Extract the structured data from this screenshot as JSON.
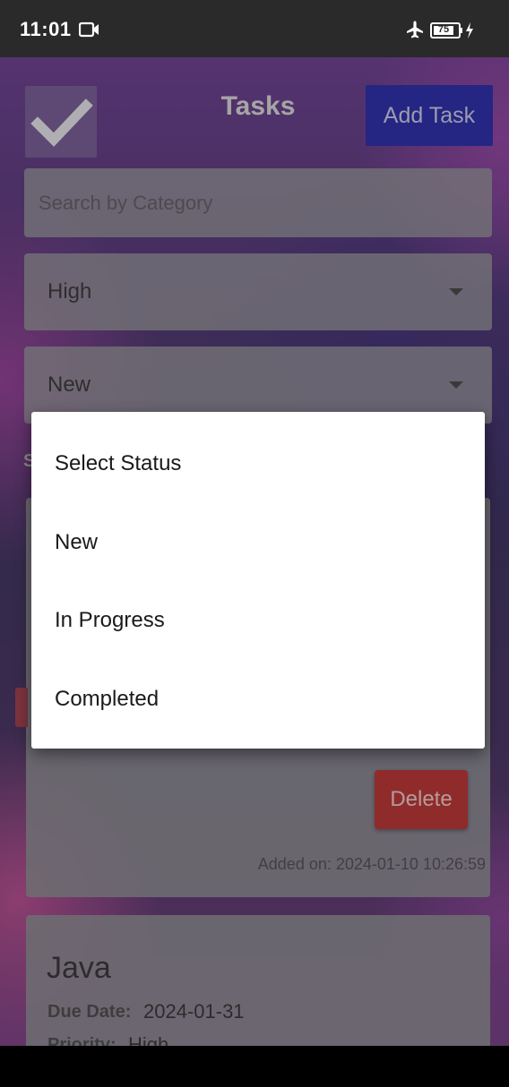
{
  "status_bar": {
    "time": "11:01",
    "battery": "75",
    "icons": [
      "video-record-icon",
      "airplane-icon",
      "battery-icon",
      "charging-icon"
    ]
  },
  "header": {
    "title": "Tasks",
    "logo_icon": "checkmark-icon",
    "add_button_label": "Add Task"
  },
  "filters": {
    "search_placeholder": "Search by Category",
    "priority_selected": "High",
    "status_selected": "New",
    "section_fragment": "S"
  },
  "status_menu": {
    "options": [
      "Select Status",
      "New",
      "In Progress",
      "Completed"
    ]
  },
  "task_card_1": {
    "delete_label": "Delete",
    "added_on": "Added on: 2024-01-10 10:26:59"
  },
  "task_card_2": {
    "title": "Java",
    "due_label": "Due Date:",
    "due_value": "2024-01-31",
    "priority_label": "Priority:",
    "priority_value": "High"
  },
  "colors": {
    "add_button": "#1414a6",
    "delete_button": "#b81e1e",
    "menu_background": "#ffffff"
  }
}
